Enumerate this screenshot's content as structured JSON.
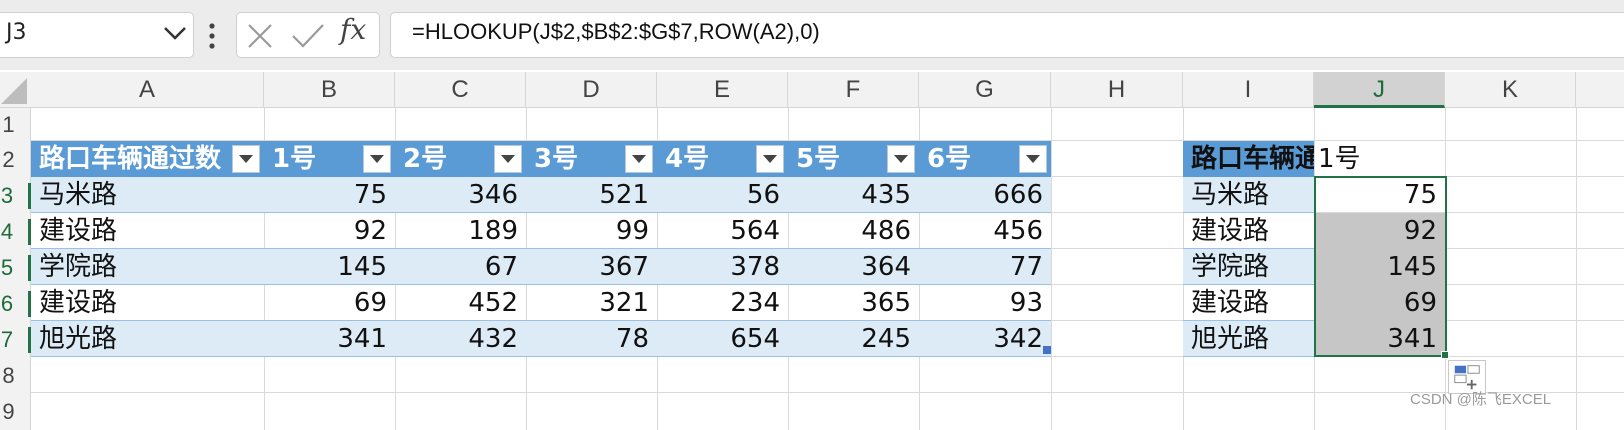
{
  "formula_bar": {
    "name_box": "J3",
    "fx_label": "fx",
    "formula": "=HLOOKUP(J$2,$B$2:$G$7,ROW(A2),0)"
  },
  "columns": [
    "A",
    "B",
    "C",
    "D",
    "E",
    "F",
    "G",
    "H",
    "I",
    "J",
    "K"
  ],
  "rows": [
    "1",
    "2",
    "3",
    "4",
    "5",
    "6",
    "7",
    "8",
    "9"
  ],
  "table": {
    "headers": [
      "路口车辆通过数",
      "1号",
      "2号",
      "3号",
      "4号",
      "5号",
      "6号"
    ],
    "rows": [
      [
        "马米路",
        "75",
        "346",
        "521",
        "56",
        "435",
        "666"
      ],
      [
        "建设路",
        "92",
        "189",
        "99",
        "564",
        "486",
        "456"
      ],
      [
        "学院路",
        "145",
        "67",
        "367",
        "378",
        "364",
        "77"
      ],
      [
        "建设路",
        "69",
        "452",
        "321",
        "234",
        "365",
        "93"
      ],
      [
        "旭光路",
        "341",
        "432",
        "78",
        "654",
        "245",
        "342"
      ]
    ]
  },
  "lookup": {
    "header_label": "路口车辆通",
    "header_value": "1号",
    "rows": [
      [
        "马米路",
        "75"
      ],
      [
        "建设路",
        "92"
      ],
      [
        "学院路",
        "145"
      ],
      [
        "建设路",
        "69"
      ],
      [
        "旭光路",
        "341"
      ]
    ]
  },
  "watermark": "CSDN @陈飞EXCEL",
  "colors": {
    "accent": "#217346",
    "table_header": "#5b9bd5",
    "band": "#ddebf7"
  }
}
